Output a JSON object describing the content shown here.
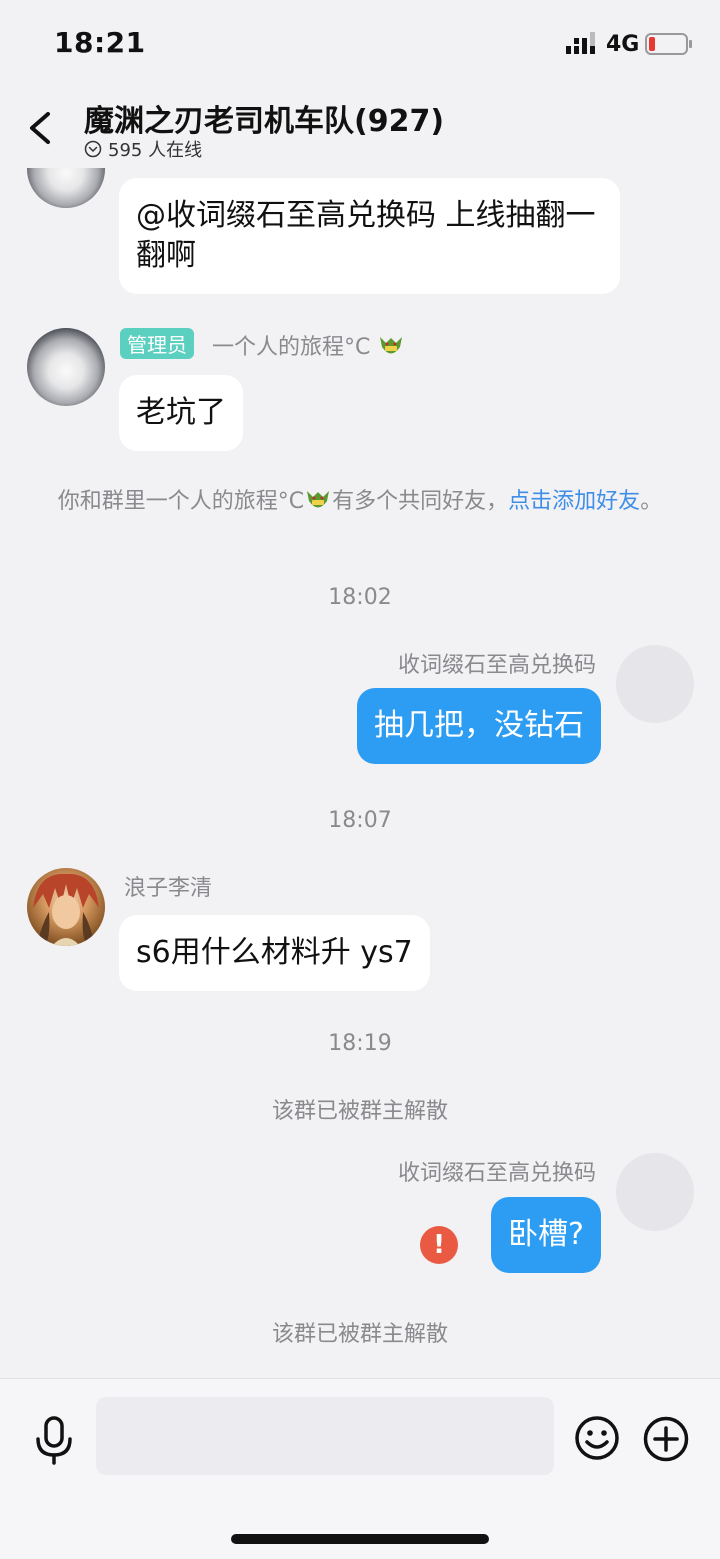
{
  "status_bar": {
    "time": "18:21",
    "network": "4G"
  },
  "header": {
    "title": "魔渊之刃老司机车队(927)",
    "online": "595 人在线"
  },
  "messages": {
    "m1": {
      "text": "@收词缀石至高兑换码 上线抽翻一翻啊"
    },
    "m2": {
      "badge": "管理员",
      "sender": "一个人的旅程°C",
      "text": "老坑了"
    },
    "tip": {
      "pre": "你和群里一个人的旅程°C",
      "mid": "有多个共同好友，",
      "link": "点击添加好友",
      "post": "。"
    },
    "t1": "18:02",
    "m3": {
      "sender": "收词缀石至高兑换码",
      "text": "抽几把，没钻石"
    },
    "t2": "18:07",
    "m4": {
      "sender": "浪子李清",
      "text": "s6用什么材料升 ys7"
    },
    "t3": "18:19",
    "notice1": "该群已被群主解散",
    "m5": {
      "sender": "收词缀石至高兑换码",
      "text": "卧槽?",
      "error_mark": "!"
    },
    "notice2": "该群已被群主解散"
  },
  "colors": {
    "self_bubble": "#2d9cf3",
    "admin_badge": "#5bd0c1",
    "error": "#ea5a43",
    "link": "#3e8ee8"
  },
  "icons": [
    "signal-icon",
    "battery-icon",
    "back-arrow-icon",
    "chevron-circle-icon",
    "dragon-emoji-icon",
    "error-icon",
    "microphone-icon",
    "smiley-icon",
    "plus-circle-icon"
  ]
}
